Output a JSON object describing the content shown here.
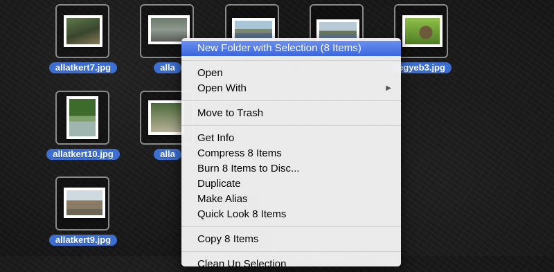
{
  "files": [
    {
      "name": "allatkert7.jpg",
      "icon": "photo-thumbnail-icon",
      "scene": "duck"
    },
    {
      "name": "alla",
      "icon": "photo-thumbnail-icon",
      "scene": "animal"
    },
    {
      "name": "",
      "icon": "photo-thumbnail-icon",
      "scene": "boats"
    },
    {
      "name": "",
      "icon": "photo-thumbnail-icon",
      "scene": "harbor"
    },
    {
      "name": "egyeb3.jpg",
      "icon": "photo-thumbnail-icon",
      "scene": "hedgehog"
    },
    {
      "name": "allatkert10.jpg",
      "icon": "photo-thumbnail-icon",
      "scene": "park"
    },
    {
      "name": "alla",
      "icon": "photo-thumbnail-icon",
      "scene": "path"
    },
    {
      "name": "allatkert9.jpg",
      "icon": "photo-thumbnail-icon",
      "scene": "ostriches"
    }
  ],
  "context_menu": {
    "groups": [
      [
        {
          "label": "New Folder with Selection (8 Items)",
          "highlighted": true
        }
      ],
      [
        {
          "label": "Open"
        },
        {
          "label": "Open With",
          "submenu": true,
          "arrow": "▶"
        }
      ],
      [
        {
          "label": "Move to Trash"
        }
      ],
      [
        {
          "label": "Get Info"
        },
        {
          "label": "Compress 8 Items"
        },
        {
          "label": "Burn 8 Items to Disc..."
        },
        {
          "label": "Duplicate"
        },
        {
          "label": "Make Alias"
        },
        {
          "label": "Quick Look 8 Items"
        }
      ],
      [
        {
          "label": "Copy 8 Items"
        }
      ],
      [
        {
          "label": "Clean Up Selection"
        }
      ]
    ]
  },
  "colors": {
    "selection_label": "#3c6fd1",
    "menu_highlight": "#3a67de",
    "desktop_background": "#161616"
  }
}
